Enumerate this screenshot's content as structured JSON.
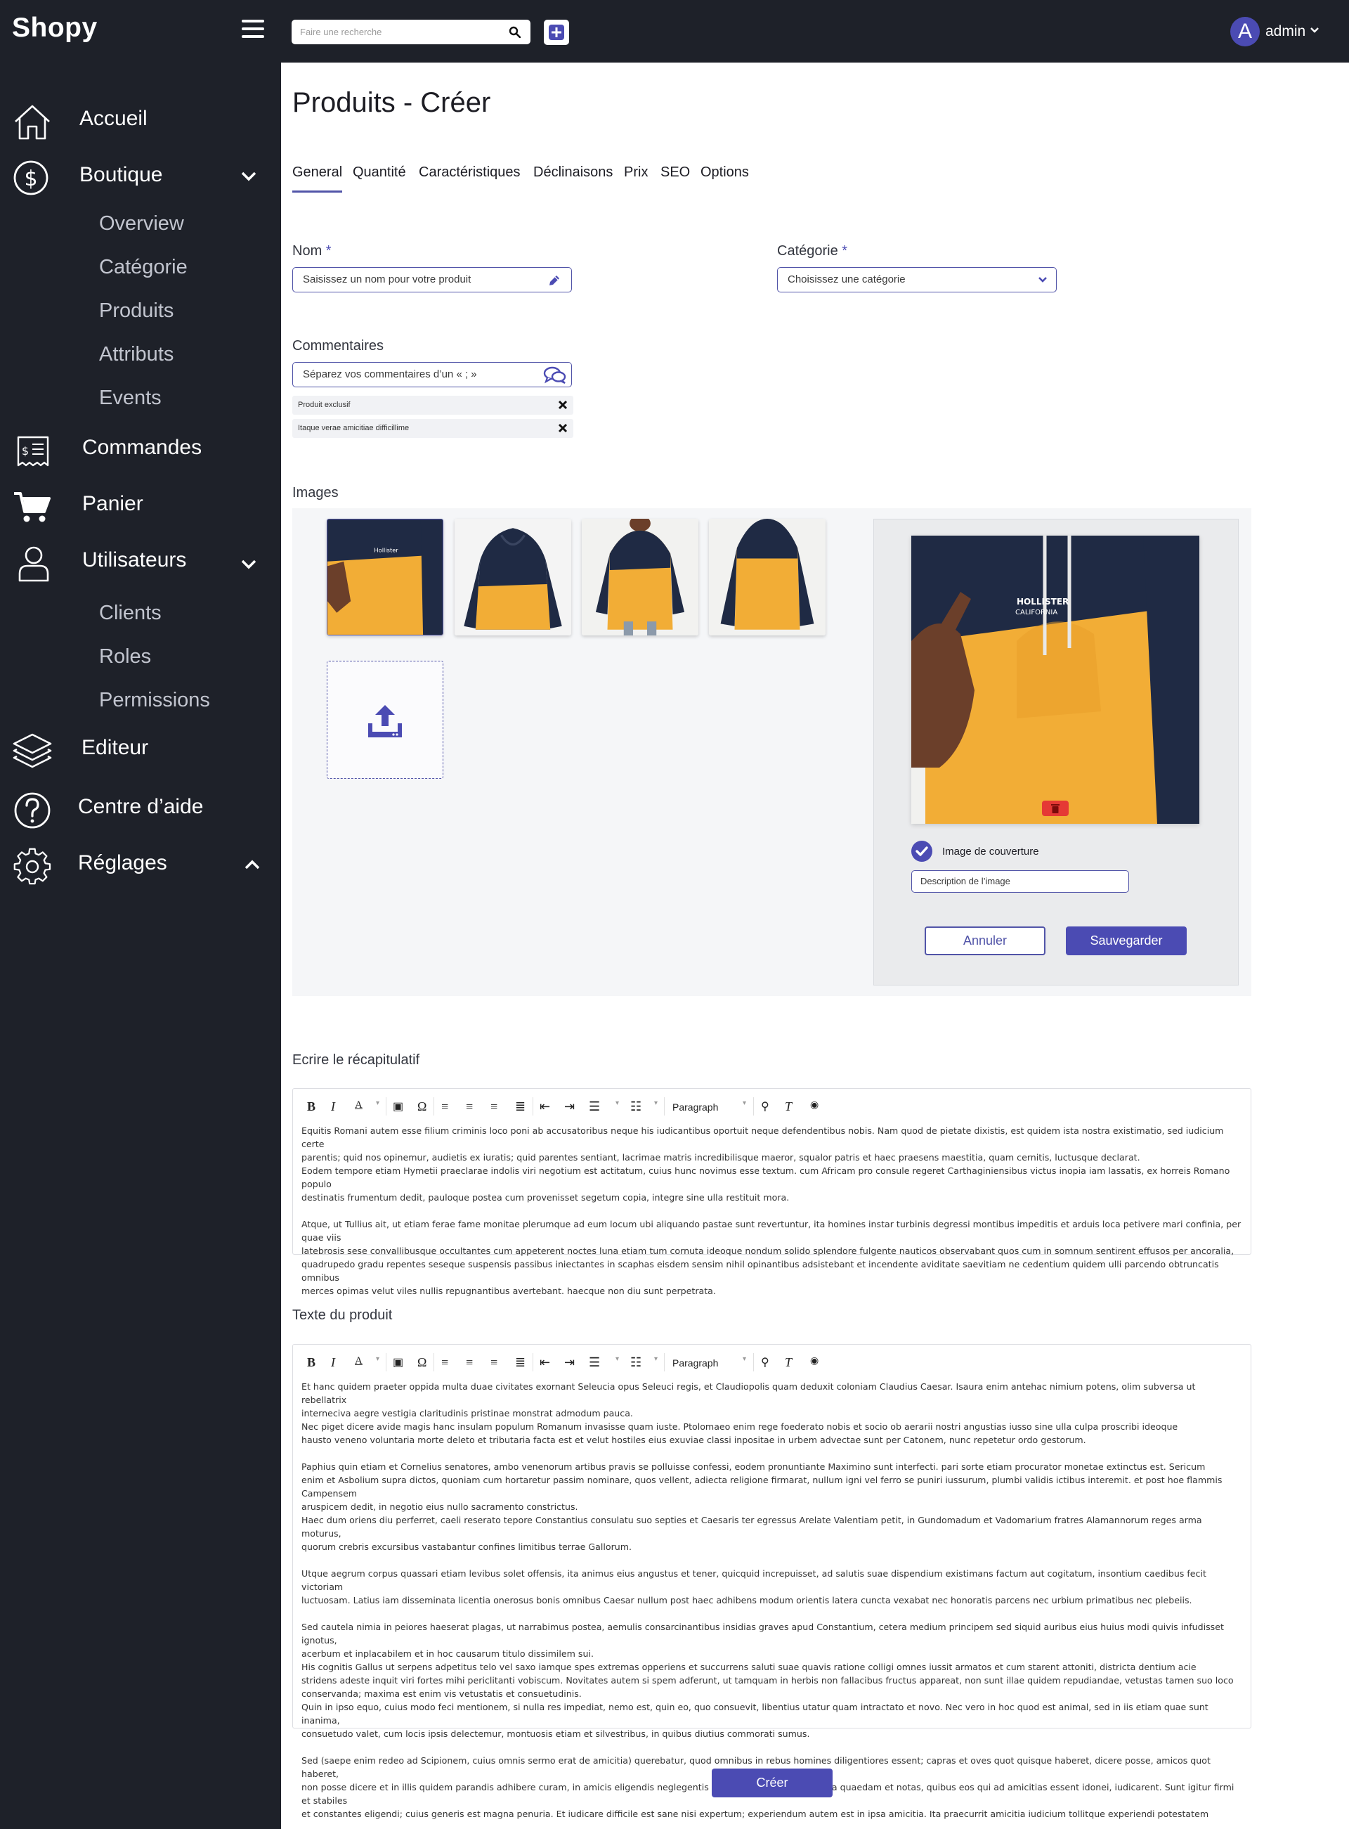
{
  "app": {
    "logo": "Shopy"
  },
  "topbar": {
    "search_placeholder": "Faire une recherche",
    "user_initial": "A",
    "user_name": "admin"
  },
  "sidebar": {
    "items": [
      {
        "label": "Accueil",
        "icon": "home-icon"
      },
      {
        "label": "Boutique",
        "icon": "dollar-circle-icon",
        "expanded": true,
        "children": [
          "Overview",
          "Catégorie",
          "Produits",
          "Attributs",
          "Events"
        ]
      },
      {
        "label": "Commandes",
        "icon": "receipt-icon"
      },
      {
        "label": "Panier",
        "icon": "cart-icon"
      },
      {
        "label": "Utilisateurs",
        "icon": "user-icon",
        "expanded": true,
        "children": [
          "Clients",
          "Roles",
          "Permissions"
        ]
      },
      {
        "label": "Editeur",
        "icon": "layers-icon"
      },
      {
        "label": "Centre d’aide",
        "icon": "help-circle-icon"
      },
      {
        "label": "Réglages",
        "icon": "gear-icon",
        "expanded": false
      }
    ]
  },
  "page": {
    "title": "Produits - Créer",
    "tabs": [
      "General",
      "Quantité",
      "Caractéristiques",
      "Déclinaisons",
      "Prix",
      "SEO",
      "Options"
    ],
    "active_tab": "General"
  },
  "form": {
    "name": {
      "label": "Nom",
      "required_mark": "*",
      "placeholder": "Saisissez un nom pour votre produit"
    },
    "category": {
      "label": "Catégorie",
      "required_mark": "*",
      "placeholder": "Choisissez une catégorie"
    },
    "comments": {
      "label": "Commentaires",
      "placeholder": "Séparez vos commentaires d’un « ; »",
      "tags": [
        "Produit exclusif",
        "Itaque verae amicitiae difficillime"
      ]
    },
    "images": {
      "label": "Images",
      "cover_label": "Image de couverture",
      "cover_checked": true,
      "description_placeholder": "Description de l’image",
      "cancel_label": "Annuler",
      "save_label": "Sauvegarder",
      "brand_print": [
        "HOLLISTER",
        "CALIFORNIA"
      ]
    },
    "summary": {
      "label": "Ecrire le récapitulatif",
      "format": "Paragraph",
      "paragraphs": [
        [
          "Equitis Romani autem esse filium criminis loco poni ab accusatoribus neque his iudicantibus oportuit neque defendentibus nobis. Nam quod de pietate dixistis, est quidem ista nostra existimatio, sed iudicium certe",
          "parentis; quid nos opinemur, audietis ex iuratis; quid parentes sentiant, lacrimae matris incredibilisque maeror, squalor patris et haec praesens maestitia, quam cernitis, luctusque declarat.",
          "Eodem tempore etiam Hymetii praeclarae indolis viri negotium est actitatum, cuius hunc novimus esse textum. cum Africam pro consule regeret Carthaginiensibus victus inopia iam lassatis, ex horreis Romano populo",
          "destinatis frumentum dedit, pauloque postea cum provenisset segetum copia, integre sine ulla restituit mora."
        ],
        [
          "Atque, ut Tullius ait, ut etiam ferae fame monitae plerumque ad eum locum ubi aliquando pastae sunt revertuntur, ita homines instar turbinis degressi montibus impeditis et arduis loca petivere mari confinia, per quae viis",
          "latebrosis sese convallibusque occultantes cum appeterent noctes luna etiam tum cornuta ideoque nondum solido splendore fulgente nauticos observabant quos cum in somnum sentirent effusos per ancoralia,",
          "quadrupedo gradu repentes seseque suspensis passibus iniectantes in scaphas eisdem sensim nihil opinantibus adsistebant et incendente aviditate saevitiam ne cedentium quidem ulli parcendo obtruncatis omnibus",
          "merces opimas velut viles nullis repugnantibus avertebant. haecque non diu sunt perpetrata."
        ]
      ]
    },
    "product_text": {
      "label": "Texte du produit",
      "format": "Paragraph",
      "paragraphs": [
        [
          "Et hanc quidem praeter oppida multa duae civitates exornant Seleucia opus Seleuci regis, et Claudiopolis quam deduxit coloniam Claudius Caesar. Isaura enim antehac nimium potens, olim subversa ut rebellatrix",
          "interneciva aegre vestigia claritudinis pristinae monstrat admodum pauca.",
          "Nec piget dicere avide magis hanc insulam populum Romanum invasisse quam iuste. Ptolomaeo enim rege foederato nobis et socio ob aerarii nostri angustias iusso sine ulla culpa proscribi ideoque",
          "hausto veneno voluntaria morte deleto et tributaria facta est et velut hostiles eius exuviae classi inpositae in urbem advectae sunt per Catonem, nunc repetetur ordo gestorum."
        ],
        [
          "Paphius quin etiam et Cornelius senatores, ambo venenorum artibus pravis se polluisse confessi, eodem pronuntiante Maximino sunt interfecti. pari sorte etiam procurator monetae extinctus est. Sericum",
          "enim et Asbolium supra dictos, quoniam cum hortaretur passim nominare, quos vellent, adiecta religione firmarat, nullum igni vel ferro se puniri iussurum, plumbi validis ictibus interemit. et post hoe flammis Campensem",
          "aruspicem dedit, in negotio eius nullo sacramento constrictus.",
          "Haec dum oriens diu perferret, caeli reserato tepore Constantius consulatu suo septies et Caesaris ter egressus Arelate Valentiam petit, in Gundomadum et Vadomarium fratres Alamannorum reges arma moturus,",
          "quorum crebris excursibus vastabantur confines limitibus terrae Gallorum."
        ],
        [
          "Utque aegrum corpus quassari etiam levibus solet offensis, ita animus eius angustus et tener, quicquid increpuisset, ad salutis suae dispendium existimans factum aut cogitatum, insontium caedibus fecit victoriam",
          "luctuosam. Latius iam disseminata licentia onerosus bonis omnibus Caesar nullum post haec adhibens modum orientis latera cuncta vexabat nec honoratis parcens nec urbium primatibus nec plebeiis."
        ],
        [
          "Sed cautela nimia in peiores haeserat plagas, ut narrabimus postea, aemulis consarcinantibus insidias graves apud Constantium, cetera medium principem sed siquid auribus eius huius modi quivis infudisset ignotus,",
          "acerbum et inplacabilem et in hoc causarum titulo dissimilem sui.",
          "His cognitis Gallus ut serpens adpetitus telo vel saxo iamque spes extremas opperiens et succurrens saluti suae quavis ratione colligi omnes iussit armatos et cum starent attoniti, districta dentium acie",
          "stridens adeste inquit viri fortes mihi periclitanti vobiscum. Novitates autem si spem adferunt, ut tamquam in herbis non fallacibus fructus appareat, non sunt illae quidem repudiandae, vetustas tamen suo loco",
          "conservanda; maxima est enim vis vetustatis et consuetudinis.",
          "Quin in ipso equo, cuius modo feci mentionem, si nulla res impediat, nemo est, quin eo, quo consuevit, libentius utatur quam intractato et novo. Nec vero in hoc quod est animal, sed in iis etiam quae sunt inanima,",
          " consuetudo valet, cum locis ipsis delectemur, montuosis etiam et silvestribus, in quibus diutius commorati sumus."
        ],
        [
          "Sed (saepe enim redeo ad Scipionem, cuius omnis sermo erat de amicitia) querebatur, quod omnibus in rebus homines diligentiores essent; capras et oves quot quisque haberet, dicere posse, amicos quot haberet,",
          "non posse dicere et in illis quidem parandis adhibere curam, in amicis eligendis neglegentis esse nec habere quasi signa quaedam et notas, quibus eos qui ad amicitias essent idonei, iudicarent. Sunt igitur firmi et stabiles",
          " et constantes eligendi; cuius generis est magna penuria. Et iudicare difficile est sane nisi expertum; experiendum autem est in ipsa amicitia. Ita praecurrit amicitia iudicium tollitque experiendi potestatem"
        ]
      ]
    },
    "create_label": "Créer"
  },
  "colors": {
    "accent": "#4b4bb3",
    "sidebar": "#1e2129",
    "danger": "#e53935",
    "hoodie_yellow": "#f2ad36",
    "hoodie_navy": "#1f2a44"
  }
}
